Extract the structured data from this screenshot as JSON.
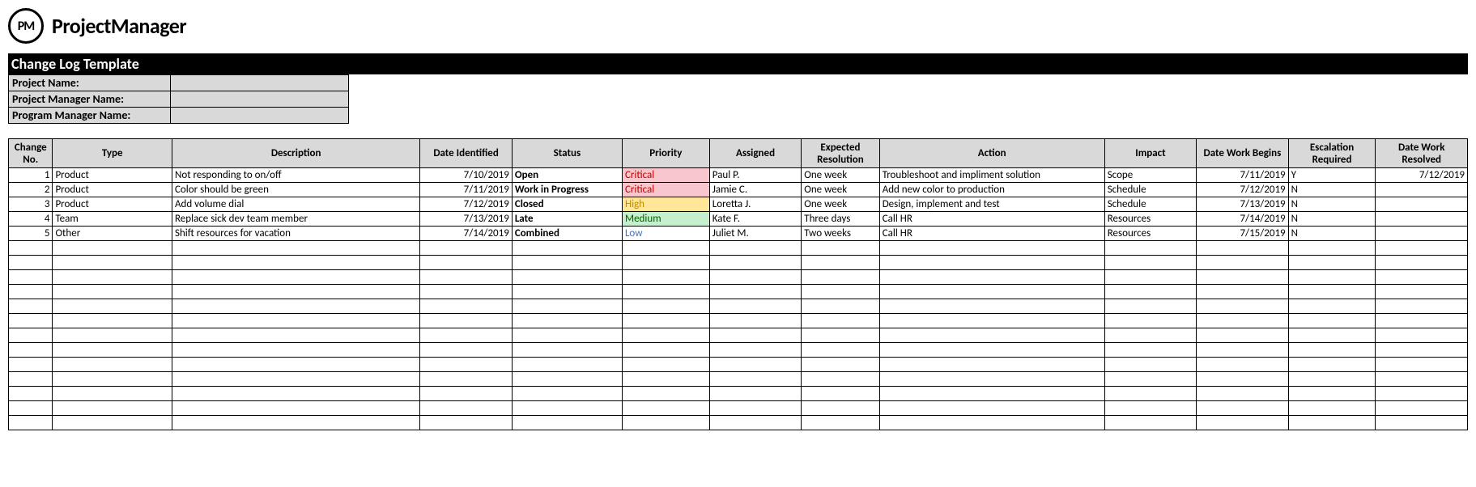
{
  "brand": {
    "badge": "PM",
    "name": "ProjectManager"
  },
  "title": "Change Log Template",
  "meta": {
    "projectNameLabel": "Project Name:",
    "projectNameValue": "",
    "pmNameLabel": "Project Manager Name:",
    "pmNameValue": "",
    "progMgrLabel": "Program Manager Name:",
    "progMgrValue": ""
  },
  "headers": {
    "no": "Change No.",
    "type": "Type",
    "desc": "Description",
    "dateId": "Date Identified",
    "status": "Status",
    "priority": "Priority",
    "assigned": "Assigned",
    "expRes": "Expected Resolution",
    "action": "Action",
    "impact": "Impact",
    "dateWb": "Date Work Begins",
    "esc": "Escalation Required",
    "dateWr": "Date Work Resolved"
  },
  "rows": [
    {
      "no": "1",
      "type": "Product",
      "desc": "Not responding to on/off",
      "dateId": "7/10/2019",
      "status": "Open",
      "priority": "Critical",
      "priorityClass": "pri-critical",
      "assigned": "Paul P.",
      "expRes": "One week",
      "action": "Troubleshoot and impliment solution",
      "impact": "Scope",
      "dateWb": "7/11/2019",
      "esc": "Y",
      "dateWr": "7/12/2019"
    },
    {
      "no": "2",
      "type": "Product",
      "desc": "Color should be green",
      "dateId": "7/11/2019",
      "status": "Work in Progress",
      "priority": "Critical",
      "priorityClass": "pri-critical",
      "assigned": "Jamie C.",
      "expRes": "One week",
      "action": "Add new color to production",
      "impact": "Schedule",
      "dateWb": "7/12/2019",
      "esc": "N",
      "dateWr": ""
    },
    {
      "no": "3",
      "type": "Product",
      "desc": "Add volume dial",
      "dateId": "7/12/2019",
      "status": "Closed",
      "priority": "High",
      "priorityClass": "pri-high",
      "assigned": "Loretta J.",
      "expRes": "One week",
      "action": "Design, implement and test",
      "impact": "Schedule",
      "dateWb": "7/13/2019",
      "esc": "N",
      "dateWr": ""
    },
    {
      "no": "4",
      "type": "Team",
      "desc": "Replace sick dev team member",
      "dateId": "7/13/2019",
      "status": "Late",
      "priority": "Medium",
      "priorityClass": "pri-medium",
      "assigned": "Kate F.",
      "expRes": "Three days",
      "action": "Call HR",
      "impact": "Resources",
      "dateWb": "7/14/2019",
      "esc": "N",
      "dateWr": ""
    },
    {
      "no": "5",
      "type": "Other",
      "desc": "Shift resources for vacation",
      "dateId": "7/14/2019",
      "status": "Combined",
      "priority": "Low",
      "priorityClass": "pri-low",
      "assigned": "Juliet M.",
      "expRes": "Two weeks",
      "action": "Call HR",
      "impact": "Resources",
      "dateWb": "7/15/2019",
      "esc": "N",
      "dateWr": ""
    }
  ],
  "emptyRowCount": 13
}
